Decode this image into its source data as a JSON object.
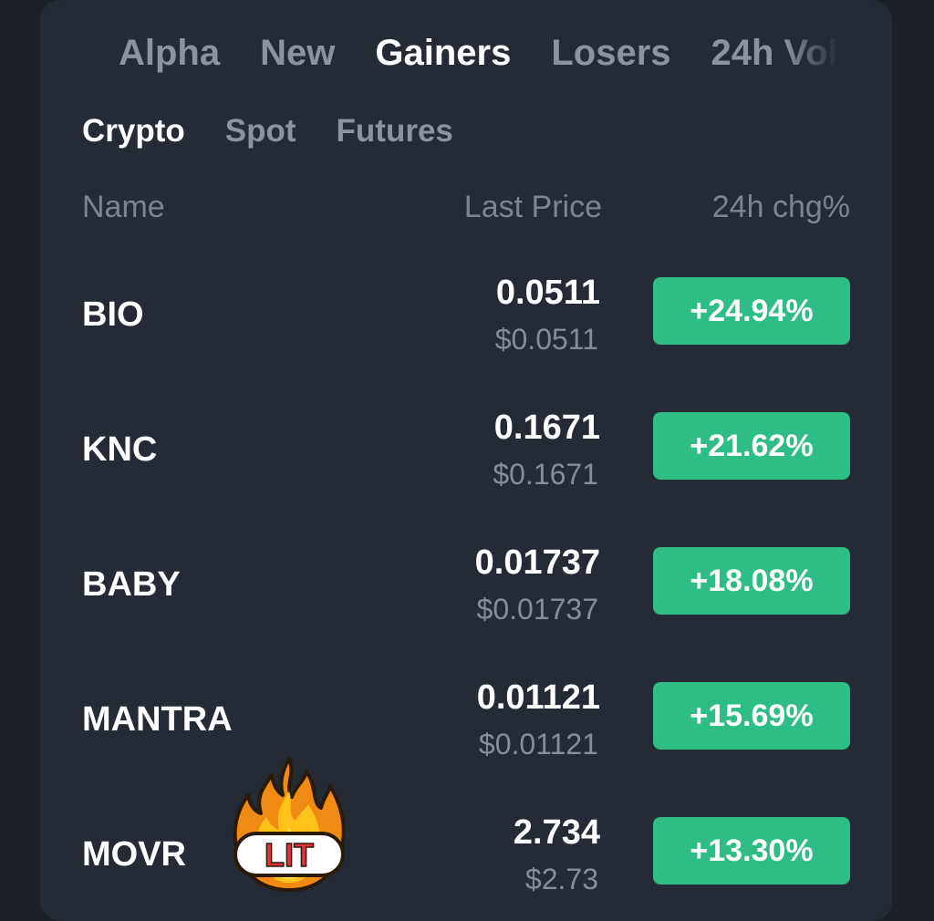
{
  "top_tabs": [
    {
      "label": "Alpha",
      "active": false
    },
    {
      "label": "New",
      "active": false
    },
    {
      "label": "Gainers",
      "active": true
    },
    {
      "label": "Losers",
      "active": false
    },
    {
      "label": "24h Vol",
      "active": false
    }
  ],
  "sub_tabs": [
    {
      "label": "Crypto",
      "active": true
    },
    {
      "label": "Spot",
      "active": false
    },
    {
      "label": "Futures",
      "active": false
    }
  ],
  "columns": {
    "name": "Name",
    "last_price": "Last Price",
    "change": "24h chg%"
  },
  "rows": [
    {
      "symbol": "BIO",
      "price": "0.0511",
      "usd": "$0.0511",
      "change": "+24.94%"
    },
    {
      "symbol": "KNC",
      "price": "0.1671",
      "usd": "$0.1671",
      "change": "+21.62%"
    },
    {
      "symbol": "BABY",
      "price": "0.01737",
      "usd": "$0.01737",
      "change": "+18.08%"
    },
    {
      "symbol": "MANTRA",
      "price": "0.01121",
      "usd": "$0.01121",
      "change": "+15.69%"
    },
    {
      "symbol": "MOVR",
      "price": "2.734",
      "usd": "$2.73",
      "change": "+13.30%"
    }
  ],
  "sticker": {
    "icon": "fire-icon",
    "text": "LIT"
  },
  "colors": {
    "background": "#1b2027",
    "panel": "#252b35",
    "gain": "#2ebd85",
    "text_primary": "#ffffff",
    "text_secondary": "#868d97"
  }
}
